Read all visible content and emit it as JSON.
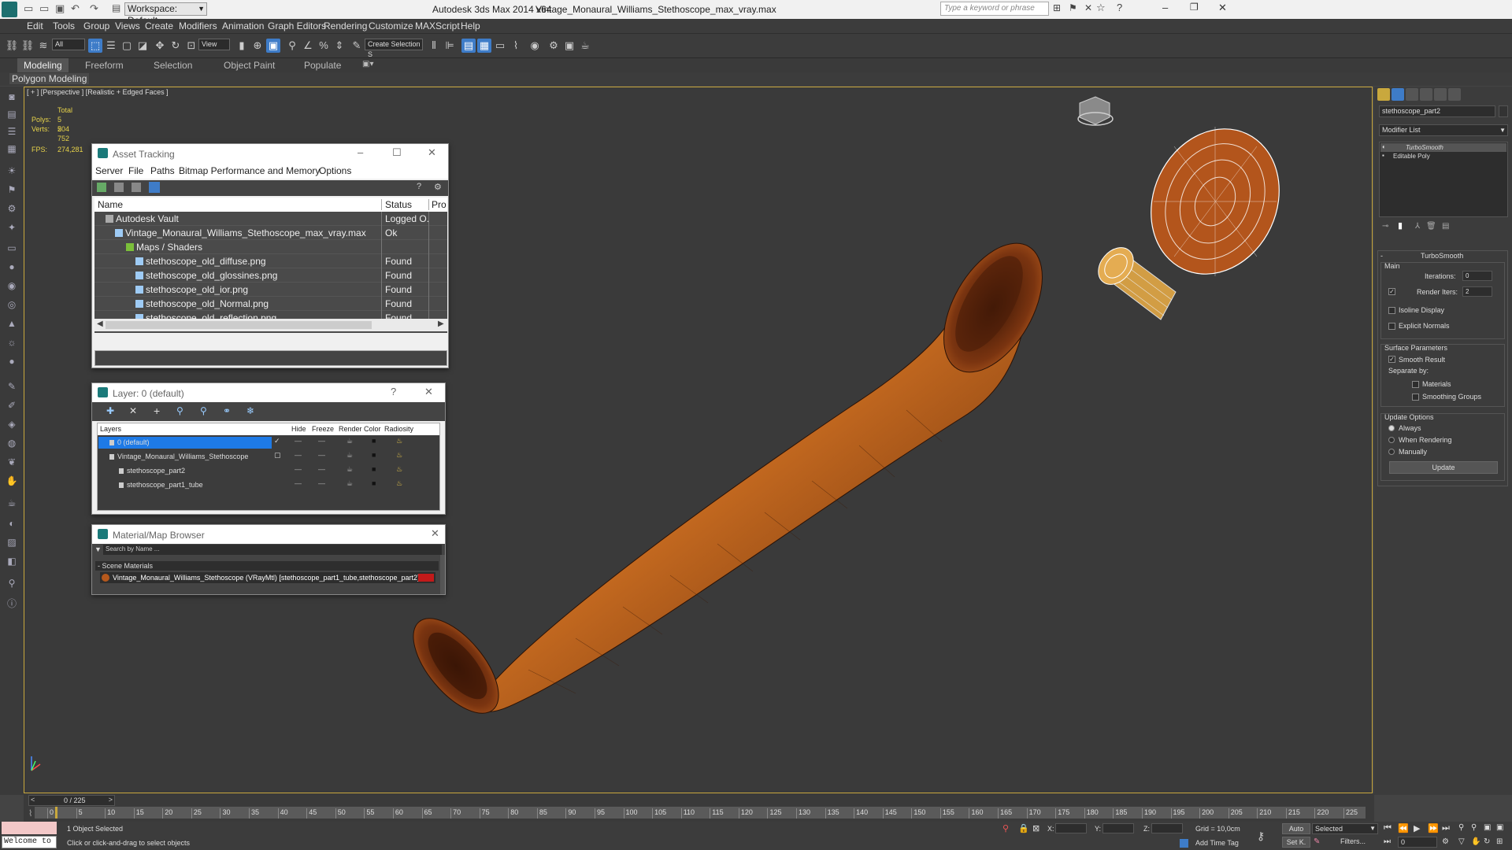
{
  "titlebar": {
    "workspace": "Workspace: Default",
    "app": "Autodesk 3ds Max  2014 x64",
    "file": "Vintage_Monaural_Williams_Stethoscope_max_vray.max",
    "search_placeholder": "Type a keyword or phrase"
  },
  "menu": [
    "Edit",
    "Tools",
    "Group",
    "Views",
    "Create",
    "Modifiers",
    "Animation",
    "Graph Editors",
    "Rendering",
    "Customize",
    "MAXScript",
    "Help"
  ],
  "toolbar": {
    "filter": "All",
    "view": "View",
    "named_selection": "Create Selection S"
  },
  "ribbon": {
    "tabs": [
      "Modeling",
      "Freeform",
      "Selection",
      "Object Paint",
      "Populate"
    ],
    "panel": "Polygon Modeling"
  },
  "viewport": {
    "label": "[ + ] [Perspective ] [Realistic + Edged Faces ]",
    "total": "Total",
    "polys_label": "Polys:",
    "polys": "5 504",
    "verts_label": "Verts:",
    "verts": "2 752",
    "fps_label": "FPS:",
    "fps": "274,281"
  },
  "asset": {
    "title": "Asset Tracking",
    "menu": [
      "Server",
      "File",
      "Paths",
      "Bitmap Performance and Memory",
      "Options"
    ],
    "headers": [
      "Name",
      "Status",
      "Pro"
    ],
    "rows": [
      {
        "name": "Autodesk Vault",
        "status": "Logged O..."
      },
      {
        "name": "Vintage_Monaural_Williams_Stethoscope_max_vray.max",
        "status": "Ok"
      },
      {
        "name": "Maps / Shaders",
        "status": ""
      },
      {
        "name": "stethoscope_old_diffuse.png",
        "status": "Found"
      },
      {
        "name": "stethoscope_old_glossines.png",
        "status": "Found"
      },
      {
        "name": "stethoscope_old_ior.png",
        "status": "Found"
      },
      {
        "name": "stethoscope_old_Normal.png",
        "status": "Found"
      },
      {
        "name": "stethoscope_old_reflection.png",
        "status": "Found"
      }
    ]
  },
  "layer": {
    "title": "Layer: 0 (default)",
    "headers": [
      "Layers",
      "Hide",
      "Freeze",
      "Render",
      "Color",
      "Radiosity"
    ],
    "rows": [
      "0 (default)",
      "Vintage_Monaural_Williams_Stethoscope",
      "stethoscope_part2",
      "stethoscope_part1_tube"
    ],
    "help": "?"
  },
  "matbrowser": {
    "title": "Material/Map Browser",
    "search_placeholder": "Search by Name ...",
    "section": "- Scene Materials",
    "material": "Vintage_Monaural_Williams_Stethoscope (VRayMtl) [stethoscope_part1_tube,stethoscope_part2]"
  },
  "cmdpanel": {
    "object_name": "stethoscope_part2",
    "modifier_list": "Modifier List",
    "stack": [
      "TurboSmooth",
      "Editable Poly"
    ],
    "rollout_title": "TurboSmooth",
    "main": "Main",
    "iterations_label": "Iterations:",
    "iterations": "0",
    "render_iters_label": "Render Iters:",
    "render_iters": "2",
    "isoline": "Isoline Display",
    "explicit": "Explicit Normals",
    "surface": "Surface Parameters",
    "smooth_result": "Smooth Result",
    "separate_by": "Separate by:",
    "materials": "Materials",
    "smoothing_groups": "Smoothing Groups",
    "update_options": "Update Options",
    "always": "Always",
    "when_rendering": "When Rendering",
    "manually": "Manually",
    "update": "Update"
  },
  "timeline": {
    "frame": "0 / 225",
    "ticks": [
      "0",
      "5",
      "10",
      "15",
      "20",
      "25",
      "30",
      "35",
      "40",
      "45",
      "50",
      "55",
      "60",
      "65",
      "70",
      "75",
      "80",
      "85",
      "90",
      "95",
      "100",
      "105",
      "110",
      "115",
      "120",
      "125",
      "130",
      "135",
      "140",
      "145",
      "150",
      "155",
      "160",
      "165",
      "170",
      "175",
      "180",
      "185",
      "190",
      "195",
      "200",
      "205",
      "210",
      "215",
      "220",
      "225"
    ]
  },
  "status": {
    "welcome": "Welcome to",
    "selected": "1 Object Selected",
    "prompt": "Click or click-and-drag to select objects",
    "x_label": "X:",
    "y_label": "Y:",
    "z_label": "Z:",
    "grid": "Grid = 10,0cm",
    "add_time_tag": "Add Time Tag",
    "auto": "Auto",
    "setk": "Set K.",
    "key_mode": "Selected",
    "filters": "Filters...",
    "frame": "0"
  },
  "colors": {
    "accent": "#3e7cc8",
    "viewport_border": "#c9a83d",
    "material_swatch": "#c21a1a",
    "wood": "#b5581c"
  }
}
